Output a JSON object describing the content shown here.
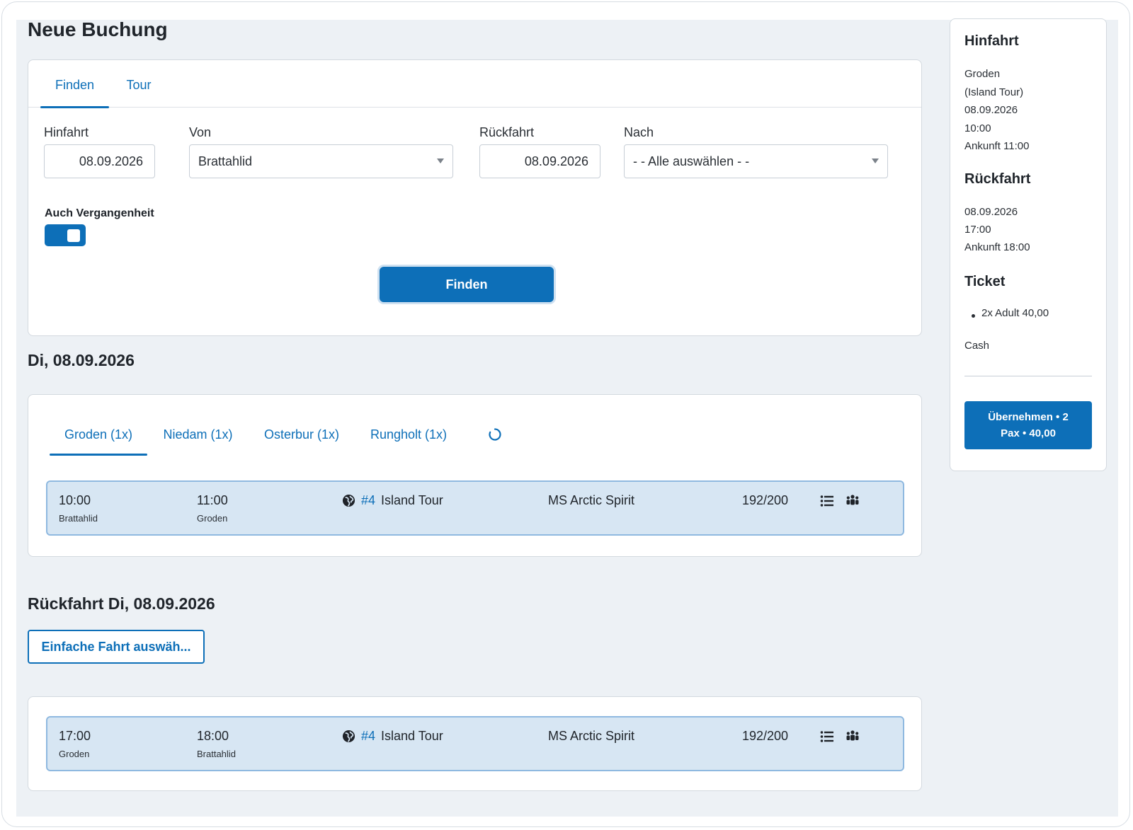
{
  "page": {
    "title": "Neue Buchung"
  },
  "search": {
    "tabs": [
      "Finden",
      "Tour"
    ],
    "outbound_label": "Hinfahrt",
    "outbound_date": "08.09.2026",
    "from_label": "Von",
    "from_value": "Brattahlid",
    "return_label": "Rückfahrt",
    "return_date": "08.09.2026",
    "to_label": "Nach",
    "to_value": "- - Alle auswählen - -",
    "past_toggle_label": "Auch Vergangenheit",
    "past_toggle_on": true,
    "find_button": "Finden"
  },
  "outbound_section": {
    "title": "Di, 08.09.2026",
    "destination_tabs": [
      "Groden (1x)",
      "Niedam (1x)",
      "Osterbur (1x)",
      "Rungholt (1x)"
    ],
    "trip": {
      "departure": "10:00",
      "departure_stop": "Brattahlid",
      "arrival": "11:00",
      "arrival_stop": "Groden",
      "tour_number": "#4",
      "tour_name": "Island Tour",
      "ship": "MS Arctic Spirit",
      "capacity": "192/200"
    }
  },
  "return_section": {
    "title": "Rückfahrt Di, 08.09.2026",
    "single_trip_button": "Einfache Fahrt auswäh...",
    "trip": {
      "departure": "17:00",
      "departure_stop": "Groden",
      "arrival": "18:00",
      "arrival_stop": "Brattahlid",
      "tour_number": "#4",
      "tour_name": "Island Tour",
      "ship": "MS Arctic Spirit",
      "capacity": "192/200"
    }
  },
  "summary": {
    "outbound_heading": "Hinfahrt",
    "outbound_lines": [
      "Groden",
      "(Island Tour)",
      "08.09.2026",
      "10:00",
      "Ankunft 11:00"
    ],
    "return_heading": "Rückfahrt",
    "return_lines": [
      "08.09.2026",
      "17:00",
      "Ankunft 18:00"
    ],
    "ticket_heading": "Ticket",
    "ticket_items": [
      "2x Adult 40,00"
    ],
    "payment": "Cash",
    "confirm_line1": "Übernehmen • 2",
    "confirm_line2": "Pax • 40,00"
  },
  "colors": {
    "accent": "#0d6fb8",
    "row_bg": "#d7e6f3",
    "canvas_bg": "#edf1f5"
  },
  "icons": [
    "refresh-icon",
    "globe-icon",
    "list-icon",
    "group-icon",
    "chevron-down-icon"
  ]
}
